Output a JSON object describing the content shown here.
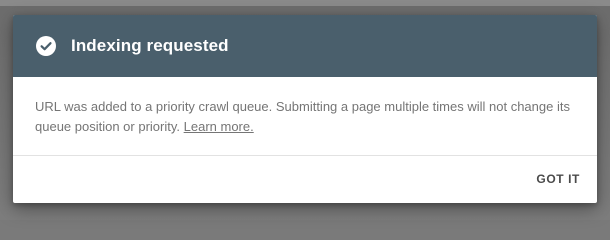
{
  "dialog": {
    "title": "Indexing requested",
    "icon": "check-circle-icon",
    "header_color": "#4a5f6c",
    "message": "URL was added to a priority crawl queue. Submitting a page multiple times will not change its queue position or priority.",
    "link_text": "Learn more.",
    "confirm_label": "GOT IT"
  }
}
